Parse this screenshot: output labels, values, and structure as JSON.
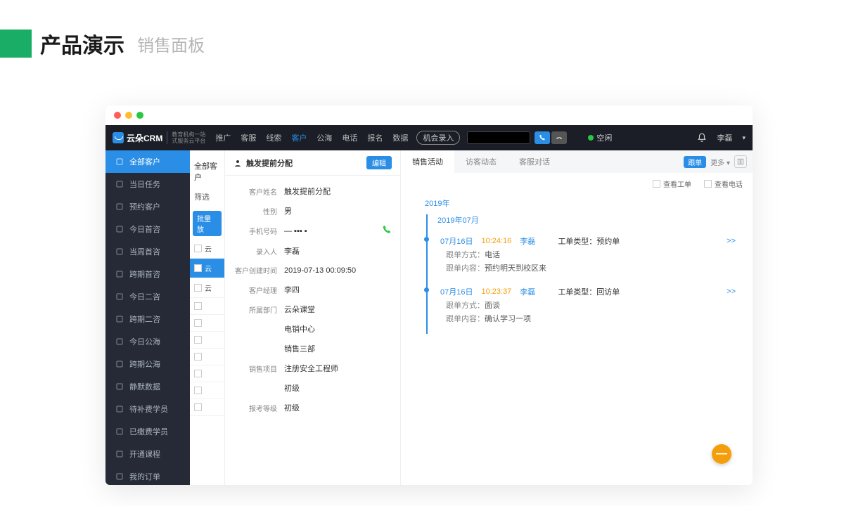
{
  "page": {
    "title_main": "产品演示",
    "title_sub": "销售面板"
  },
  "topnav": {
    "logo_text": "云朵CRM",
    "logo_sub1": "教育机构一站",
    "logo_sub2": "式服务云平台",
    "items": [
      "推广",
      "客服",
      "线索",
      "客户",
      "公海",
      "电话",
      "报名",
      "数据"
    ],
    "active_index": 3,
    "opportunity_btn": "机会录入",
    "status": "空闲",
    "user": "李磊"
  },
  "sidebar": {
    "items": [
      {
        "label": "全部客户",
        "active": true
      },
      {
        "label": "当日任务"
      },
      {
        "label": "预约客户"
      },
      {
        "label": "今日首咨"
      },
      {
        "label": "当周首咨"
      },
      {
        "label": "跨期首咨"
      },
      {
        "label": "今日二咨"
      },
      {
        "label": "跨期二咨"
      },
      {
        "label": "今日公海"
      },
      {
        "label": "跨期公海"
      },
      {
        "label": "静默数据"
      },
      {
        "label": "待补费学员"
      },
      {
        "label": "已缴费学员"
      },
      {
        "label": "开通课程"
      },
      {
        "label": "我的订单"
      }
    ]
  },
  "list_peek": {
    "header": "全部客户",
    "filter": "筛选",
    "batch_btn": "批量放",
    "rows": [
      "云",
      "云",
      "云",
      "",
      "",
      "",
      "",
      "",
      "",
      ""
    ]
  },
  "detail": {
    "header_title": "触发提前分配",
    "edit_btn": "编辑",
    "fields": [
      {
        "label": "客户姓名",
        "value": "触发提前分配"
      },
      {
        "label": "性别",
        "value": "男"
      },
      {
        "label": "手机号码",
        "value": "— ▪▪▪ ▪",
        "phone": true
      },
      {
        "label": "录入人",
        "value": "李磊"
      },
      {
        "label": "客户创建时间",
        "value": "2019-07-13 00:09:50"
      },
      {
        "label": "客户经理",
        "value": "李四"
      },
      {
        "label": "所属部门",
        "value": "云朵课堂"
      },
      {
        "label": "",
        "value": "电销中心"
      },
      {
        "label": "",
        "value": "销售三部"
      },
      {
        "label": "销售项目",
        "value": "注册安全工程师"
      },
      {
        "label": "",
        "value": "初级"
      },
      {
        "label": "报考等级",
        "value": "初级"
      }
    ]
  },
  "activity": {
    "tabs": [
      "销售活动",
      "访客动态",
      "客服对话"
    ],
    "active_tab": 0,
    "tag": "跟单",
    "more": "更多 ▾",
    "check1": "查看工单",
    "check2": "查看电话",
    "year": "2019年",
    "month": "2019年07月",
    "entries": [
      {
        "date": "07月16日",
        "time": "10:24:16",
        "user": "李磊",
        "type_label": "工单类型：",
        "type_value": "预约单",
        "more": ">>",
        "lines": [
          {
            "k": "跟单方式：",
            "v": "电话"
          },
          {
            "k": "跟单内容：",
            "v": "预约明天到校区来"
          }
        ]
      },
      {
        "date": "07月16日",
        "time": "10:23:37",
        "user": "李磊",
        "type_label": "工单类型：",
        "type_value": "回访单",
        "more": ">>",
        "lines": [
          {
            "k": "跟单方式：",
            "v": "面谈"
          },
          {
            "k": "跟单内容：",
            "v": "确认学习一项"
          }
        ]
      }
    ]
  },
  "fab": "—"
}
